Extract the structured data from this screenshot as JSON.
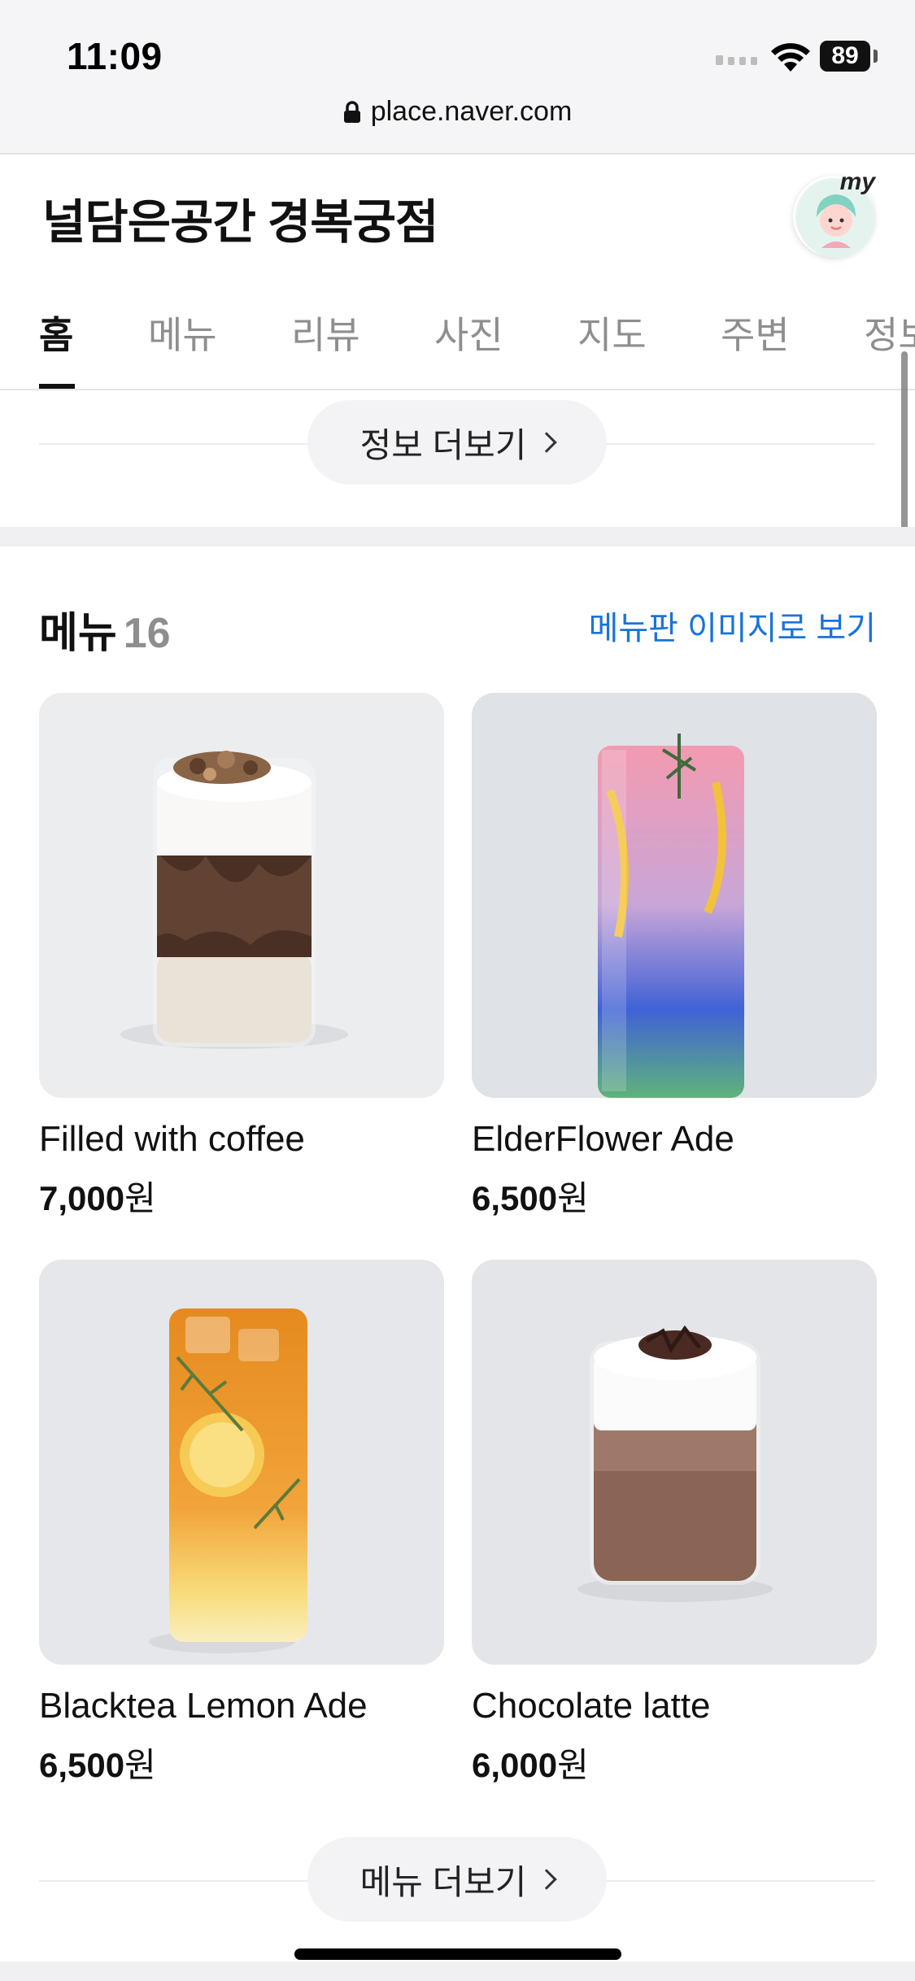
{
  "status_bar": {
    "time": "11:09",
    "battery": "89",
    "url": "place.naver.com"
  },
  "header": {
    "title": "널담은공간 경복궁점",
    "avatar_badge": "my"
  },
  "tabs": [
    {
      "label": "홈",
      "active": true
    },
    {
      "label": "메뉴",
      "active": false
    },
    {
      "label": "리뷰",
      "active": false
    },
    {
      "label": "사진",
      "active": false
    },
    {
      "label": "지도",
      "active": false
    },
    {
      "label": "주변",
      "active": false
    },
    {
      "label": "정보",
      "active": false
    }
  ],
  "info_more": {
    "label": "정보 더보기"
  },
  "menu": {
    "heading": "메뉴",
    "count": "16",
    "image_link": "메뉴판 이미지로 보기",
    "items": [
      {
        "name": "Filled with coffee",
        "price": "7,000",
        "currency": "원"
      },
      {
        "name": "ElderFlower Ade",
        "price": "6,500",
        "currency": "원"
      },
      {
        "name": "Blacktea Lemon Ade",
        "price": "6,500",
        "currency": "원"
      },
      {
        "name": "Chocolate latte",
        "price": "6,000",
        "currency": "원"
      }
    ],
    "more_label": "메뉴 더보기"
  },
  "colors": {
    "link": "#1a73d9",
    "text": "#111111",
    "muted": "#8e8e8e",
    "pill_bg": "#f3f3f5"
  }
}
